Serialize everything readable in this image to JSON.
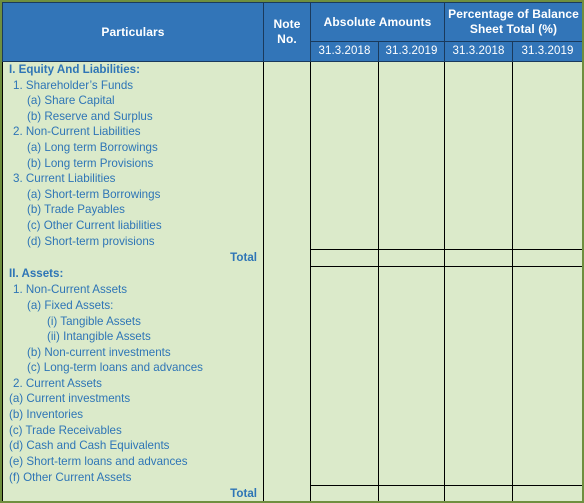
{
  "colors": {
    "header_bg": "#3275b8",
    "header_text": "#ffffff",
    "body_bg": "#dbeaca",
    "body_text": "#2e75b6",
    "grid_line": "#000000",
    "outer_frame": "#6f8f3f"
  },
  "header": {
    "particulars": "Particulars",
    "note_no": "Note\nNo.",
    "note_no_line1": "Note",
    "note_no_line2": "No.",
    "absolute_amounts": "Absolute Amounts",
    "percentage": "Percentage of Balance Sheet Total (%)",
    "percentage_line1": "Percentage of Balance",
    "percentage_line2": "Sheet Total (%)",
    "subheaders": [
      "31.3.2018",
      "31.3.2019",
      "31.3.2018",
      "31.3.2019"
    ]
  },
  "rows": [
    {
      "label": "I. Equity And Liabilities:",
      "level": "h",
      "type": "section"
    },
    {
      "label": "1. Shareholder’s Funds",
      "level": "1",
      "type": "item"
    },
    {
      "label": "(a) Share Capital",
      "level": "2",
      "type": "item"
    },
    {
      "label": "(b) Reserve and Surplus",
      "level": "2",
      "type": "item"
    },
    {
      "label": "2. Non-Current Liabilities",
      "level": "1",
      "type": "item"
    },
    {
      "label": "(a) Long term Borrowings",
      "level": "2",
      "type": "item"
    },
    {
      "label": "(b) Long term Provisions",
      "level": "2",
      "type": "item"
    },
    {
      "label": "3. Current Liabilities",
      "level": "1",
      "type": "item"
    },
    {
      "label": "(a) Short-term Borrowings",
      "level": "2",
      "type": "item"
    },
    {
      "label": "(b) Trade Payables",
      "level": "2",
      "type": "item"
    },
    {
      "label": "(c) Other Current liabilities",
      "level": "2",
      "type": "item"
    },
    {
      "label": "(d) Short-term provisions",
      "level": "2",
      "type": "item"
    },
    {
      "label": "Total",
      "level": "total",
      "type": "total"
    },
    {
      "label": "II. Assets:",
      "level": "h",
      "type": "section"
    },
    {
      "label": "1. Non-Current Assets",
      "level": "1",
      "type": "item"
    },
    {
      "label": "(a) Fixed Assets:",
      "level": "2",
      "type": "item"
    },
    {
      "label": "(i) Tangible Assets",
      "level": "3",
      "type": "item"
    },
    {
      "label": "(ii) Intangible Assets",
      "level": "3",
      "type": "item"
    },
    {
      "label": "(b) Non-current investments",
      "level": "2",
      "type": "item"
    },
    {
      "label": "(c) Long-term loans and advances",
      "level": "2",
      "type": "item"
    },
    {
      "label": "2. Current Assets",
      "level": "1",
      "type": "item"
    },
    {
      "label": "(a) Current investments",
      "level": "0",
      "type": "item"
    },
    {
      "label": "(b) Inventories",
      "level": "0",
      "type": "item"
    },
    {
      "label": "(c) Trade Receivables",
      "level": "0",
      "type": "item"
    },
    {
      "label": "(d) Cash and Cash Equivalents",
      "level": "0",
      "type": "item"
    },
    {
      "label": "(e) Short-term loans and advances",
      "level": "0",
      "type": "item"
    },
    {
      "label": "(f) Other Current Assets",
      "level": "0",
      "type": "item"
    },
    {
      "label": "Total",
      "level": "total",
      "type": "total"
    }
  ],
  "cell_values": {
    "note_no": "",
    "amount": ""
  }
}
